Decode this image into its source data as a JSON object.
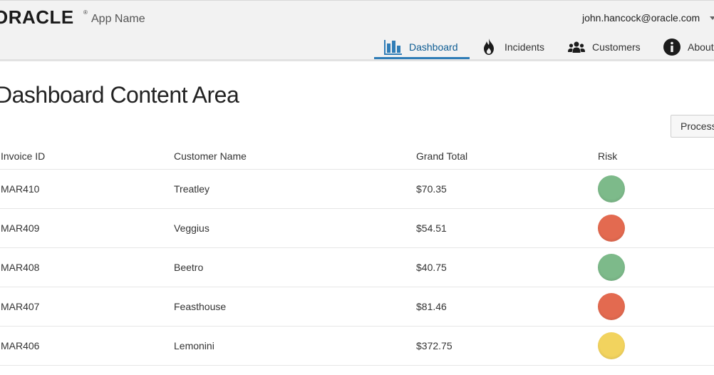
{
  "header": {
    "logo_text": "ORACLE",
    "logo_mark": "®",
    "app_name": "App Name",
    "user": "john.hancock@oracle.com"
  },
  "nav": [
    {
      "label": "Dashboard",
      "icon": "bar-chart-icon",
      "active": true
    },
    {
      "label": "Incidents",
      "icon": "flame-icon",
      "active": false
    },
    {
      "label": "Customers",
      "icon": "people-icon",
      "active": false
    },
    {
      "label": "About",
      "icon": "info-icon",
      "active": false
    }
  ],
  "main": {
    "title": "Dashboard Content Area",
    "process_button": "Process"
  },
  "table": {
    "columns": [
      "Invoice ID",
      "Customer Name",
      "Grand Total",
      "Risk"
    ],
    "rows": [
      {
        "invoice": "MAR410",
        "customer": "Treatley",
        "total": "$70.35",
        "risk": "low",
        "risk_color": "#7dba8a"
      },
      {
        "invoice": "MAR409",
        "customer": "Veggius",
        "total": "$54.51",
        "risk": "high",
        "risk_color": "#e36a50"
      },
      {
        "invoice": "MAR408",
        "customer": "Beetro",
        "total": "$40.75",
        "risk": "low",
        "risk_color": "#7dba8a"
      },
      {
        "invoice": "MAR407",
        "customer": "Feasthouse",
        "total": "$81.46",
        "risk": "high",
        "risk_color": "#e36a50"
      },
      {
        "invoice": "MAR406",
        "customer": "Lemonini",
        "total": "$372.75",
        "risk": "medium",
        "risk_color": "#f2d35e"
      }
    ]
  },
  "colors": {
    "accent": "#2f7db7",
    "header_bg": "#f2f2f2"
  }
}
